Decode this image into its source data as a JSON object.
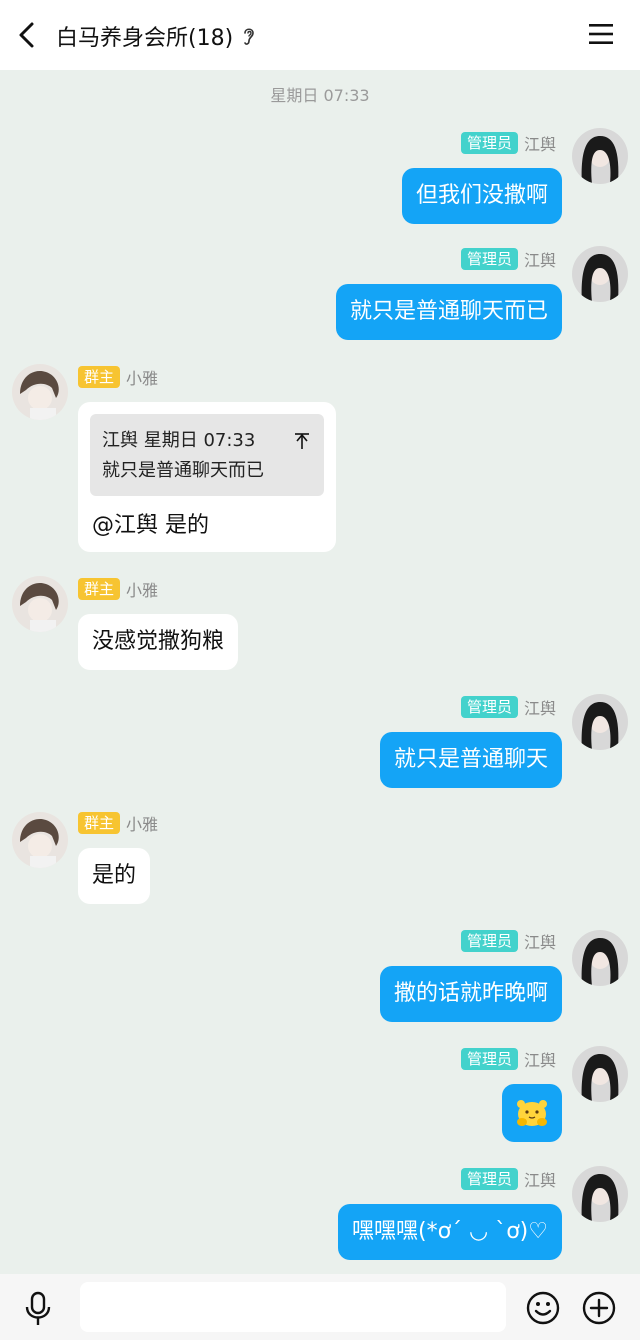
{
  "header": {
    "title": "白马养身会所(18)",
    "back_icon": "back-arrow-icon",
    "ear_icon": "ear-icon",
    "menu_icon": "menu-icon"
  },
  "timestamp": "星期日 07:33",
  "badges": {
    "admin": "管理员",
    "owner": "群主"
  },
  "senders": {
    "admin_name": "江舆",
    "owner_name": "小雅"
  },
  "messages": [
    {
      "side": "right",
      "badge": "管理员",
      "sender": "江舆",
      "text": "但我们没撒啊"
    },
    {
      "side": "right",
      "badge": "管理员",
      "sender": "江舆",
      "text": "就只是普通聊天而已"
    },
    {
      "side": "left",
      "badge": "群主",
      "sender": "小雅",
      "quote_header": "江舆 星期日 07:33",
      "quote_text": "就只是普通聊天而已",
      "text": "@江舆 是的"
    },
    {
      "side": "left",
      "badge": "群主",
      "sender": "小雅",
      "text": "没感觉撒狗粮"
    },
    {
      "side": "right",
      "badge": "管理员",
      "sender": "江舆",
      "text": "就只是普通聊天"
    },
    {
      "side": "left",
      "badge": "群主",
      "sender": "小雅",
      "text": "是的"
    },
    {
      "side": "right",
      "badge": "管理员",
      "sender": "江舆",
      "text": "撒的话就昨晚啊"
    },
    {
      "side": "right",
      "badge": "管理员",
      "sender": "江舆",
      "emoji": "bear-hug-emoji"
    },
    {
      "side": "right",
      "badge": "管理员",
      "sender": "江舆",
      "text": "嘿嘿嘿(*ơ´ ◡ `ơ)♡"
    }
  ],
  "input": {
    "placeholder": "",
    "value": ""
  },
  "icons": {
    "mic": "mic-icon",
    "emoji": "emoji-icon",
    "plus": "plus-icon"
  },
  "colors": {
    "bubble_blue": "#14a4f6",
    "admin_badge": "#43d2cc",
    "owner_badge": "#f7c431",
    "background": "#eaf0ec"
  }
}
